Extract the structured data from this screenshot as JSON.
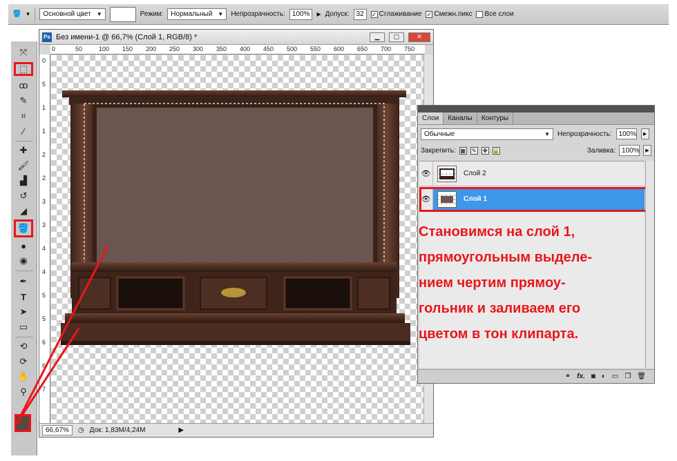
{
  "options_bar": {
    "fill_source": "Основной цвет",
    "mode_label": "Режим:",
    "mode_value": "Нормальный",
    "opacity_label": "Непрозрачность:",
    "opacity_value": "100%",
    "tolerance_label": "Допуск:",
    "tolerance_value": "32",
    "antialias_label": "Сглаживание",
    "contiguous_label": "Смежн.пикс",
    "all_layers_label": "Все слои"
  },
  "document": {
    "title": "Без имени-1 @ 66,7% (Слой 1, RGB/8) *",
    "ps_logo": "Ps",
    "zoom": "66,67%",
    "doc_size": "Док: 1,83M/4,24M",
    "ruler_h": [
      "0",
      "50",
      "100",
      "150",
      "200",
      "250",
      "300",
      "350",
      "400",
      "450",
      "500",
      "550",
      "600",
      "650",
      "700",
      "750"
    ],
    "ruler_v": [
      "0",
      "5",
      "1",
      "1",
      "2",
      "2",
      "3",
      "3",
      "4",
      "4",
      "5",
      "5",
      "6",
      "6",
      "7"
    ]
  },
  "layers_panel": {
    "tabs": [
      "Слои",
      "Каналы",
      "Контуры"
    ],
    "blend_mode": "Обычные",
    "opacity_label": "Непрозрачность:",
    "opacity_value": "100%",
    "lock_label": "Закрепить:",
    "fill_label": "Заливка:",
    "fill_value": "100%",
    "layers": [
      {
        "name": "Слой 2",
        "selected": false
      },
      {
        "name": "Слой 1",
        "selected": true
      }
    ],
    "footer_fx": "fx."
  },
  "instruction_lines": [
    "Становимся на слой 1,",
    "прямоугольным выделе-",
    "нием чертим прямоу-",
    "гольник и заливаем его",
    "цветом в тон клипарта."
  ],
  "colors": {
    "highlight": "#e8161c",
    "fill_brown": "#6a5550",
    "selected_layer": "#3e97e8",
    "wood": "#4a2c21"
  },
  "tools": [
    "move-icon",
    "marquee-icon",
    "lasso-icon",
    "quick-select-icon",
    "crop-icon",
    "eyedropper-icon",
    "healing-icon",
    "brush-icon",
    "stamp-icon",
    "history-brush-icon",
    "eraser-icon",
    "paint-bucket-icon",
    "blur-icon",
    "dodge-icon",
    "pen-icon",
    "type-icon",
    "path-select-icon",
    "shape-icon",
    "3d-rotate-icon",
    "3d-orbit-icon",
    "hand-icon",
    "zoom-icon"
  ]
}
